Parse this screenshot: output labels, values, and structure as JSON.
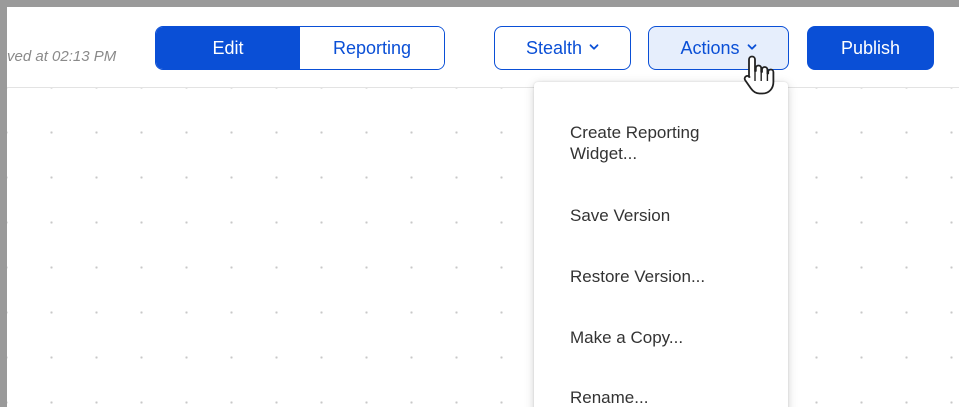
{
  "toolbar": {
    "saved_status": "ved at 02:13 PM",
    "mode_tabs": [
      {
        "label": "Edit",
        "selected": true
      },
      {
        "label": "Reporting",
        "selected": false
      }
    ],
    "stealth_label": "Stealth",
    "actions_label": "Actions",
    "publish_label": "Publish"
  },
  "actions_menu": {
    "items": [
      {
        "label": "Create Reporting Widget..."
      },
      {
        "label": "Save Version"
      },
      {
        "label": "Restore Version..."
      },
      {
        "label": "Make a Copy..."
      },
      {
        "label": "Rename..."
      }
    ]
  },
  "icons": {
    "stealth_chevron": "chevron-down-icon",
    "actions_chevron": "chevron-down-icon",
    "cursor": "hand-pointer-icon"
  },
  "colors": {
    "primary": "#0a4fd6",
    "actions_bg": "#e6eefc",
    "text": "#333333",
    "muted_text": "#8a8a8a"
  }
}
